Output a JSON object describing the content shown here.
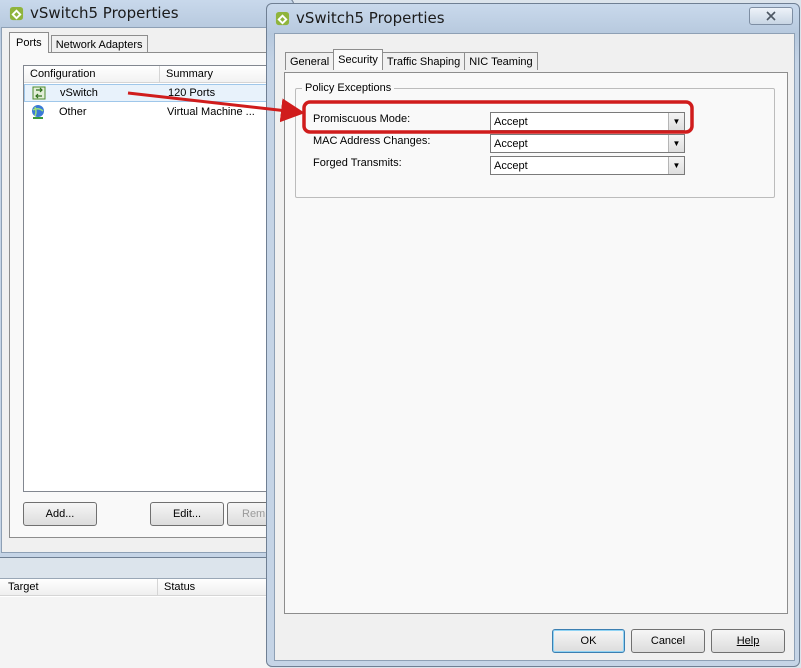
{
  "bg_window": {
    "title": "vSwitch5 Properties",
    "tabs": [
      "Ports",
      "Network Adapters"
    ],
    "columns": [
      "Configuration",
      "Summary"
    ],
    "rows": [
      {
        "config": "vSwitch",
        "summary": "120 Ports",
        "icon": "vswitch-icon"
      },
      {
        "config": "Other",
        "summary": "Virtual Machine ...",
        "icon": "network-globe-icon"
      }
    ],
    "buttons": {
      "add": "Add...",
      "edit": "Edit...",
      "remove": "Rem"
    }
  },
  "task_bar": {
    "columns": [
      "Target",
      "Status"
    ]
  },
  "dialog": {
    "title": "vSwitch5 Properties",
    "close_icon": "close-icon",
    "tabs": [
      "General",
      "Security",
      "Traffic Shaping",
      "NIC Teaming"
    ],
    "active_tab": "Security",
    "group_title": "Policy Exceptions",
    "fields": [
      {
        "label": "Promiscuous Mode:",
        "value": "Accept"
      },
      {
        "label": "MAC Address Changes:",
        "value": "Accept"
      },
      {
        "label": "Forged Transmits:",
        "value": "Accept"
      }
    ],
    "buttons": {
      "ok": "OK",
      "cancel": "Cancel",
      "help": "Help"
    }
  },
  "colors": {
    "highlight": "#d01c1c",
    "arrow": "#d01c1c"
  }
}
